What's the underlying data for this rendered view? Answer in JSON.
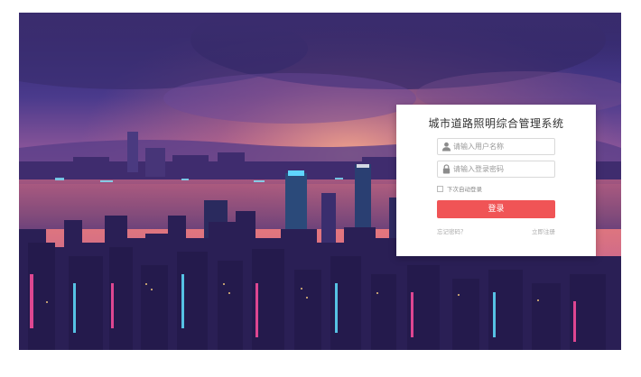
{
  "app": {
    "title": "城市道路照明综合管理系统"
  },
  "login": {
    "username_placeholder": "请输入用户名称",
    "password_placeholder": "请输入登录密码",
    "remember_label": "下次自动登录",
    "submit_label": "登录",
    "forgot_label": "忘记密码？",
    "register_label": "立即注册"
  },
  "colors": {
    "button": "#f05456",
    "sky_top": "#3a2a73",
    "sky_glow": "#f07a73",
    "city_dark": "#231a4a"
  },
  "icons": {
    "user": "user-icon",
    "password": "lock-icon"
  }
}
